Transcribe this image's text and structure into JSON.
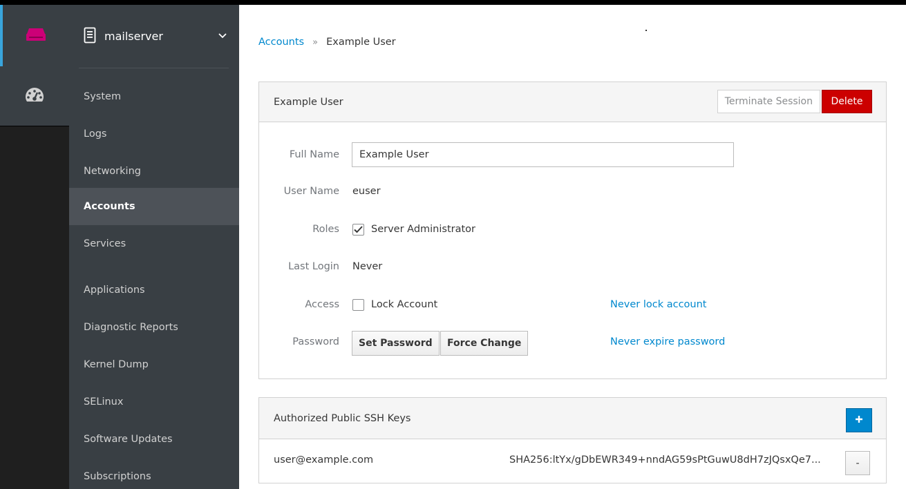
{
  "host": {
    "name": "mailserver",
    "icon": "server-icon",
    "chevron": "chevron-down-icon"
  },
  "rail": {
    "host_icon": "host-icon",
    "dashboard_icon": "dashboard-icon",
    "accent_color": "#cc0077"
  },
  "nav": {
    "items": [
      {
        "label": "System"
      },
      {
        "label": "Logs"
      },
      {
        "label": "Networking"
      },
      {
        "label": "Accounts"
      },
      {
        "label": "Services"
      },
      {
        "label": "Applications"
      },
      {
        "label": "Diagnostic Reports"
      },
      {
        "label": "Kernel Dump"
      },
      {
        "label": "SELinux"
      },
      {
        "label": "Software Updates"
      },
      {
        "label": "Subscriptions"
      }
    ],
    "active": "Accounts"
  },
  "breadcrumb": {
    "link": "Accounts",
    "separator": "»",
    "current": "Example User"
  },
  "user_panel": {
    "title": "Example User",
    "terminate_label": "Terminate Session",
    "delete_label": "Delete",
    "fields": {
      "full_name_label": "Full Name",
      "full_name_value": "Example User",
      "user_name_label": "User Name",
      "user_name_value": "euser",
      "roles_label": "Roles",
      "role_admin_label": "Server Administrator",
      "role_admin_checked": true,
      "last_login_label": "Last Login",
      "last_login_value": "Never",
      "access_label": "Access",
      "lock_account_label": "Lock Account",
      "lock_account_checked": false,
      "never_lock_link": "Never lock account",
      "password_label": "Password",
      "set_password_label": "Set Password",
      "force_change_label": "Force Change",
      "never_expire_link": "Never expire password"
    }
  },
  "ssh_panel": {
    "title": "Authorized Public SSH Keys",
    "add_icon": "plus-icon",
    "keys": [
      {
        "user": "user@example.com",
        "fingerprint": "SHA256:ltYx/gDbEWR349+nndAG59sPtGuwU8dH7zJQsxQe7...",
        "remove_label": "-"
      }
    ]
  },
  "colors": {
    "link": "#0088ce",
    "danger": "#cc0000",
    "sidebar": "#393f44",
    "active_item": "#4d5258"
  }
}
